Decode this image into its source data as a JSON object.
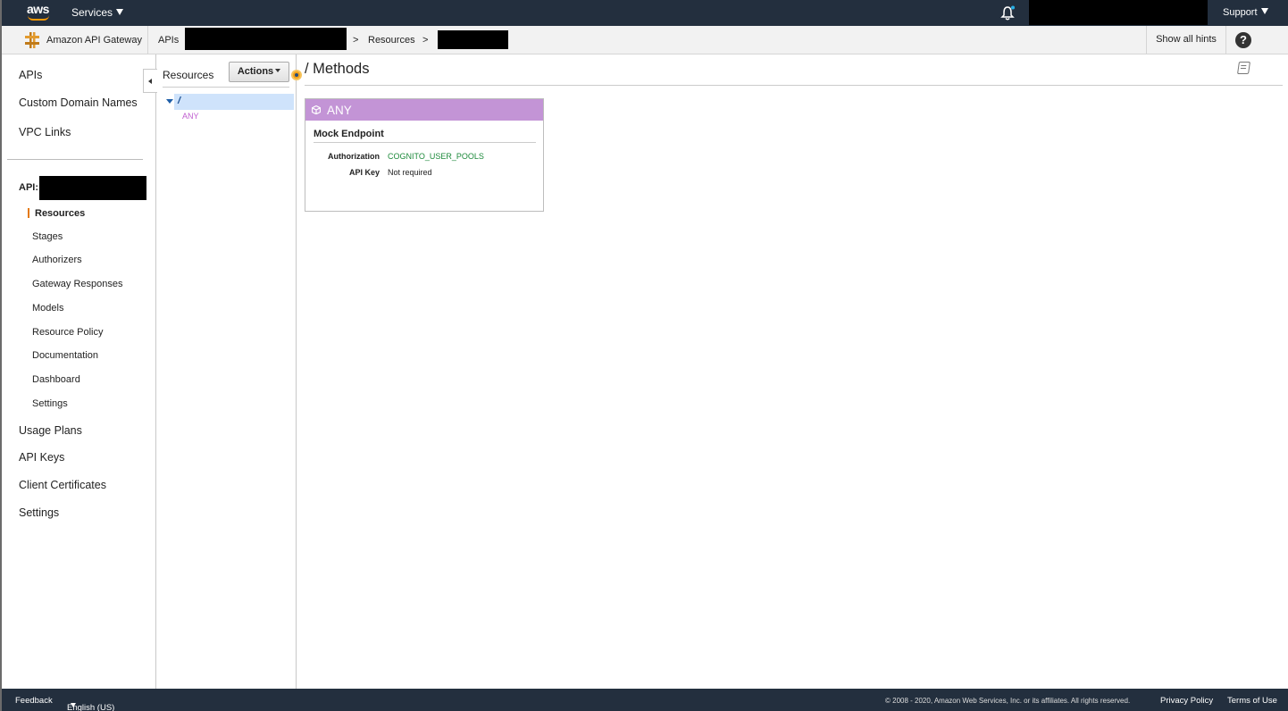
{
  "topnav": {
    "logo_text": "aws",
    "services_label": "Services",
    "support_label": "Support",
    "icons": {
      "notification": "bell-icon"
    }
  },
  "breadcrumb": {
    "service_name": "Amazon API Gateway",
    "apis": "APIs",
    "sep1": ">",
    "resources": "Resources",
    "sep2": ">",
    "show_hints": "Show all hints",
    "help": "?"
  },
  "leftnav": {
    "top_items": [
      "APIs",
      "Custom Domain Names",
      "VPC Links"
    ],
    "api_label": "API:",
    "api_sub_items": [
      "Resources",
      "Stages",
      "Authorizers",
      "Gateway Responses",
      "Models",
      "Resource Policy",
      "Documentation",
      "Dashboard",
      "Settings"
    ],
    "bottom_items": [
      "Usage Plans",
      "API Keys",
      "Client Certificates",
      "Settings"
    ],
    "active_item": "Resources"
  },
  "resources_panel": {
    "title": "Resources",
    "actions_label": "Actions",
    "tree": {
      "root": "/",
      "methods": [
        "ANY"
      ]
    }
  },
  "main": {
    "title": "/ Methods",
    "method_card": {
      "method": "ANY",
      "integration": "Mock Endpoint",
      "authorization_key": "Authorization",
      "authorization_value": "COGNITO_USER_POOLS",
      "api_key_key": "API Key",
      "api_key_value": "Not required"
    }
  },
  "footer": {
    "feedback": "Feedback",
    "language": "English (US)",
    "copyright": "© 2008 - 2020, Amazon Web Services, Inc. or its affiliates. All rights reserved.",
    "privacy": "Privacy Policy",
    "terms": "Terms of Use"
  },
  "colors": {
    "nav_bg": "#232f3e",
    "accent_orange": "#ff9900",
    "method_any": "#c394d6",
    "authorization_green": "#1d8a3b",
    "selected_tree": "#cfe3fb"
  }
}
